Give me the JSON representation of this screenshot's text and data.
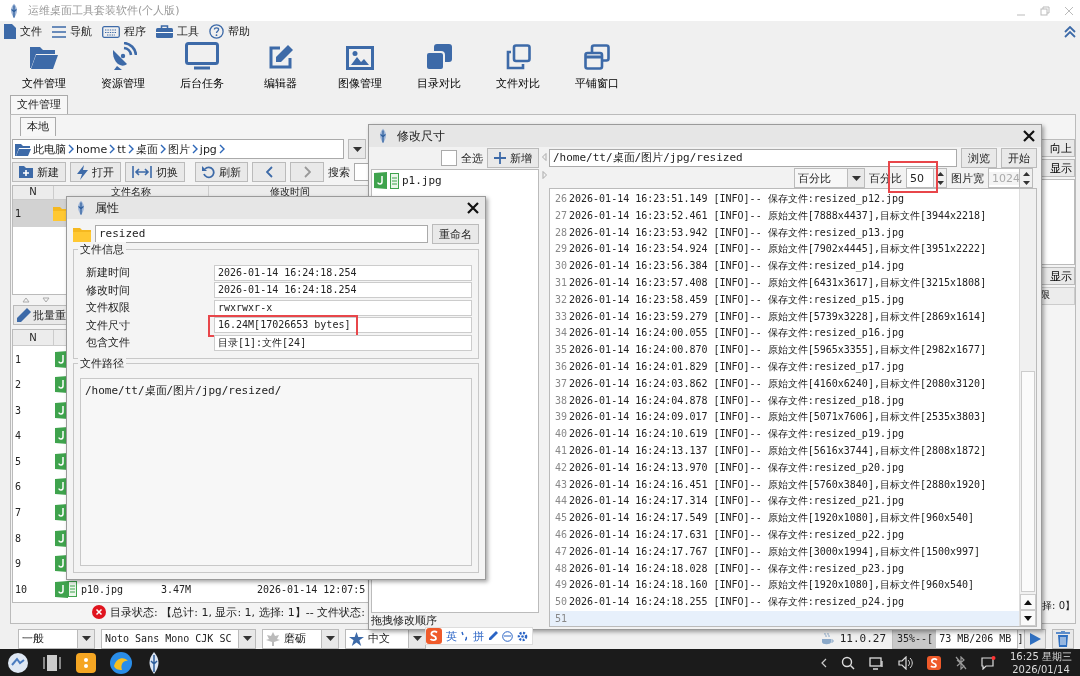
{
  "window": {
    "title": "运维桌面工具套装软件(个人版)"
  },
  "menu": [
    "文件",
    "导航",
    "程序",
    "工具",
    "帮助"
  ],
  "toolbar": [
    "文件管理",
    "资源管理",
    "后台任务",
    "编辑器",
    "图像管理",
    "目录对比",
    "文件对比",
    "平铺窗口"
  ],
  "main_tabs": [
    {
      "label": "文件管理",
      "selected": true
    }
  ],
  "sub_tabs": [
    {
      "label": "本地",
      "selected": true
    }
  ],
  "breadcrumb": [
    "此电脑",
    "home",
    "tt",
    "桌面",
    "图片",
    "jpg"
  ],
  "file_buttons": [
    "新建",
    "打开",
    "切换",
    "刷新"
  ],
  "search": {
    "label": "搜索"
  },
  "file_table": {
    "columns": [
      "N",
      "文件名称",
      "修改时间"
    ],
    "rows": [
      {
        "n": "1",
        "selected": true
      }
    ]
  },
  "batch_button": "批量重",
  "batch_table": {
    "columns": [
      "N"
    ],
    "rows": [
      {
        "n": "1"
      },
      {
        "n": "2"
      },
      {
        "n": "3"
      },
      {
        "n": "4"
      },
      {
        "n": "5"
      },
      {
        "n": "6"
      },
      {
        "n": "7"
      },
      {
        "n": "8"
      },
      {
        "n": "9"
      },
      {
        "n": "10",
        "name": "p10.jpg",
        "size": "3.47M",
        "modified": "2026-01-14 12:07:5"
      }
    ]
  },
  "status": "目录状态: 【总计: 1, 显示: 1, 选择: 1】-- 文件状态:",
  "right_panel": {
    "buttons": [
      "向上",
      "显示"
    ],
    "lower_button": "显示",
    "column_header": "限",
    "status": "择: 0】"
  },
  "bottom_bar": {
    "dropdowns": [
      "一般",
      "Noto Sans Mono CJK SC",
      "磨砺",
      "中文"
    ],
    "java_version": "11.0.27",
    "memory": {
      "text": "35%--[ 73 MB/206 MB ]",
      "level": 0.35
    }
  },
  "ime_bar": [
    "英",
    "拼"
  ],
  "resize_dialog": {
    "title": "修改尺寸",
    "select_all": {
      "label": "全选",
      "checked": false
    },
    "add_button": "新增",
    "files": [
      "p1.jpg"
    ],
    "hint": "拖拽修改顺序",
    "path": "/home/tt/桌面/图片/jpg/resized",
    "buttons": [
      "浏览",
      "开始"
    ],
    "mode": "百分比",
    "percent_label": "百分比",
    "percent": {
      "value": "50",
      "highlighted": true
    },
    "width_label": "图片宽",
    "width": {
      "value": "1024",
      "disabled": true
    },
    "log": [
      {
        "n": "26",
        "text": "2026-01-14 16:23:51.149 [INFO]-- 保存文件:resized_p12.jpg",
        "current": false
      },
      {
        "n": "27",
        "text": "2026-01-14 16:23:52.461 [INFO]-- 原始文件[7888x4437],目标文件[3944x2218]",
        "current": false
      },
      {
        "n": "28",
        "text": "2026-01-14 16:23:53.942 [INFO]-- 保存文件:resized_p13.jpg",
        "current": false
      },
      {
        "n": "29",
        "text": "2026-01-14 16:23:54.924 [INFO]-- 原始文件[7902x4445],目标文件[3951x2222]",
        "current": false
      },
      {
        "n": "30",
        "text": "2026-01-14 16:23:56.384 [INFO]-- 保存文件:resized_p14.jpg",
        "current": false
      },
      {
        "n": "31",
        "text": "2026-01-14 16:23:57.408 [INFO]-- 原始文件[6431x3617],目标文件[3215x1808]",
        "current": false
      },
      {
        "n": "32",
        "text": "2026-01-14 16:23:58.459 [INFO]-- 保存文件:resized_p15.jpg",
        "current": false
      },
      {
        "n": "33",
        "text": "2026-01-14 16:23:59.279 [INFO]-- 原始文件[5739x3228],目标文件[2869x1614]",
        "current": false
      },
      {
        "n": "34",
        "text": "2026-01-14 16:24:00.055 [INFO]-- 保存文件:resized_p16.jpg",
        "current": false
      },
      {
        "n": "35",
        "text": "2026-01-14 16:24:00.870 [INFO]-- 原始文件[5965x3355],目标文件[2982x1677]",
        "current": false
      },
      {
        "n": "36",
        "text": "2026-01-14 16:24:01.829 [INFO]-- 保存文件:resized_p17.jpg",
        "current": false
      },
      {
        "n": "37",
        "text": "2026-01-14 16:24:03.862 [INFO]-- 原始文件[4160x6240],目标文件[2080x3120]",
        "current": false
      },
      {
        "n": "38",
        "text": "2026-01-14 16:24:04.878 [INFO]-- 保存文件:resized_p18.jpg",
        "current": false
      },
      {
        "n": "39",
        "text": "2026-01-14 16:24:09.017 [INFO]-- 原始文件[5071x7606],目标文件[2535x3803]",
        "current": false
      },
      {
        "n": "40",
        "text": "2026-01-14 16:24:10.619 [INFO]-- 保存文件:resized_p19.jpg",
        "current": false
      },
      {
        "n": "41",
        "text": "2026-01-14 16:24:13.137 [INFO]-- 原始文件[5616x3744],目标文件[2808x1872]",
        "current": false
      },
      {
        "n": "42",
        "text": "2026-01-14 16:24:13.970 [INFO]-- 保存文件:resized_p20.jpg",
        "current": false
      },
      {
        "n": "43",
        "text": "2026-01-14 16:24:16.451 [INFO]-- 原始文件[5760x3840],目标文件[2880x1920]",
        "current": false
      },
      {
        "n": "44",
        "text": "2026-01-14 16:24:17.314 [INFO]-- 保存文件:resized_p21.jpg",
        "current": false
      },
      {
        "n": "45",
        "text": "2026-01-14 16:24:17.549 [INFO]-- 原始文件[1920x1080],目标文件[960x540]",
        "current": false
      },
      {
        "n": "46",
        "text": "2026-01-14 16:24:17.631 [INFO]-- 保存文件:resized_p22.jpg",
        "current": false
      },
      {
        "n": "47",
        "text": "2026-01-14 16:24:17.767 [INFO]-- 原始文件[3000x1994],目标文件[1500x997]",
        "current": false
      },
      {
        "n": "48",
        "text": "2026-01-14 16:24:18.028 [INFO]-- 保存文件:resized_p23.jpg",
        "current": false
      },
      {
        "n": "49",
        "text": "2026-01-14 16:24:18.160 [INFO]-- 原始文件[1920x1080],目标文件[960x540]",
        "current": false
      },
      {
        "n": "50",
        "text": "2026-01-14 16:24:18.255 [INFO]-- 保存文件:resized_p24.jpg",
        "current": false
      },
      {
        "n": "51",
        "current": true
      }
    ]
  },
  "properties_dialog": {
    "title": "属性",
    "name": "resized",
    "rename_button": "重命名",
    "info_title": "文件信息",
    "fields": [
      {
        "label": "新建时间",
        "value": "2026-01-14 16:24:18.254",
        "highlighted": false
      },
      {
        "label": "修改时间",
        "value": "2026-01-14 16:24:18.254",
        "highlighted": false
      },
      {
        "label": "文件权限",
        "value": "rwxrwxr-x",
        "highlighted": false
      },
      {
        "label": "文件尺寸",
        "value": "16.24M[17026653 bytes]",
        "highlighted": true
      },
      {
        "label": "包含文件",
        "value": "目录[1]:文件[24]",
        "highlighted": false
      }
    ],
    "path_title": "文件路径",
    "path": "/home/tt/桌面/图片/jpg/resized/"
  },
  "taskbar": {
    "clock_time": "16:25 星期三",
    "clock_date": "2026/01/14"
  }
}
